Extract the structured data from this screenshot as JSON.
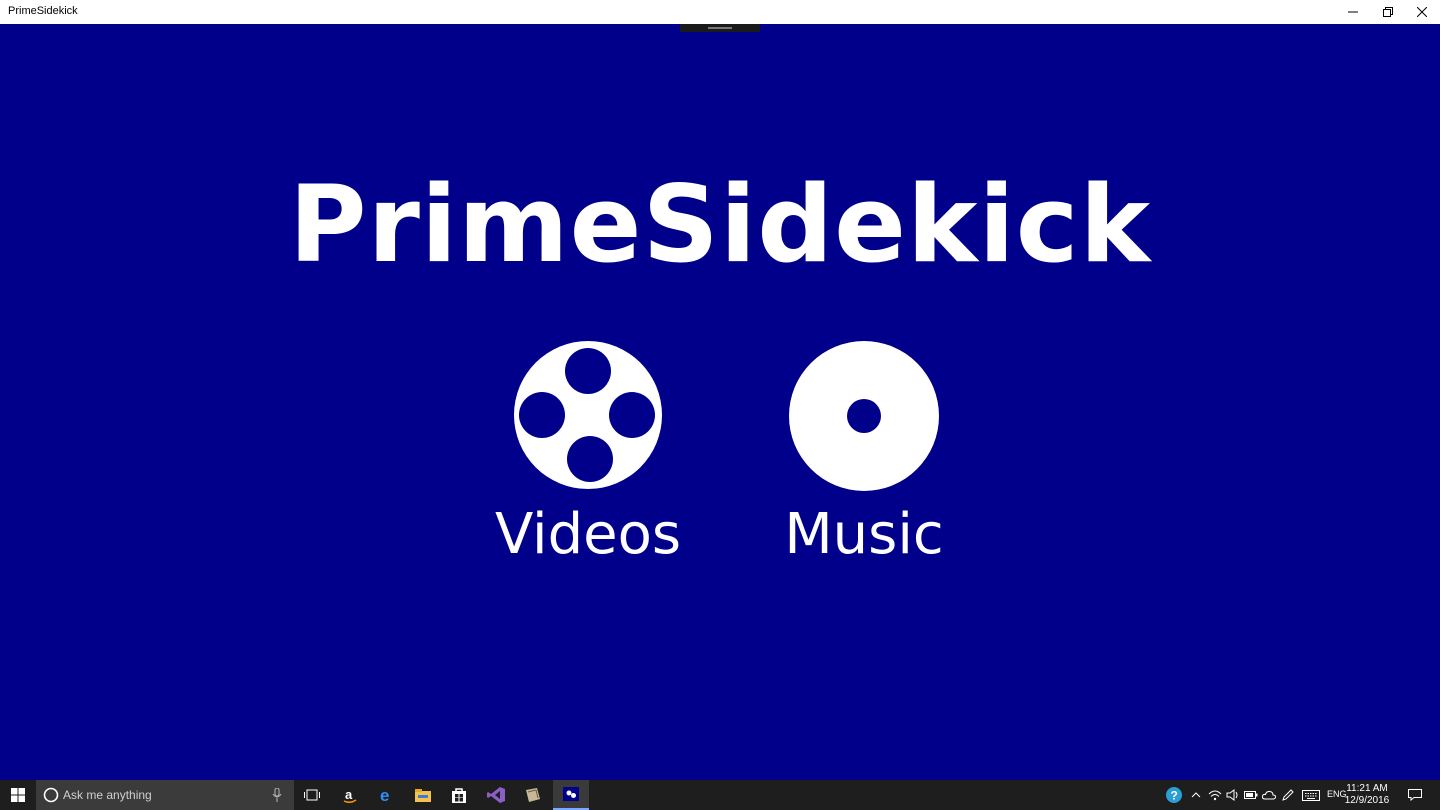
{
  "window": {
    "title": "PrimeSidekick"
  },
  "app": {
    "title": "PrimeSidekick",
    "background_color": "#00008b",
    "tiles": [
      {
        "label": "Videos",
        "icon": "film-reel-icon"
      },
      {
        "label": "Music",
        "icon": "disc-icon"
      }
    ]
  },
  "taskbar": {
    "search_placeholder": "Ask me anything",
    "apps": [
      "task-view-icon",
      "amazon-icon",
      "edge-icon",
      "file-explorer-icon",
      "store-icon",
      "visual-studio-icon",
      "app-generic-icon",
      "primesidekick-icon"
    ],
    "language": "ENG",
    "time": "11:21 AM",
    "date": "12/9/2016"
  }
}
